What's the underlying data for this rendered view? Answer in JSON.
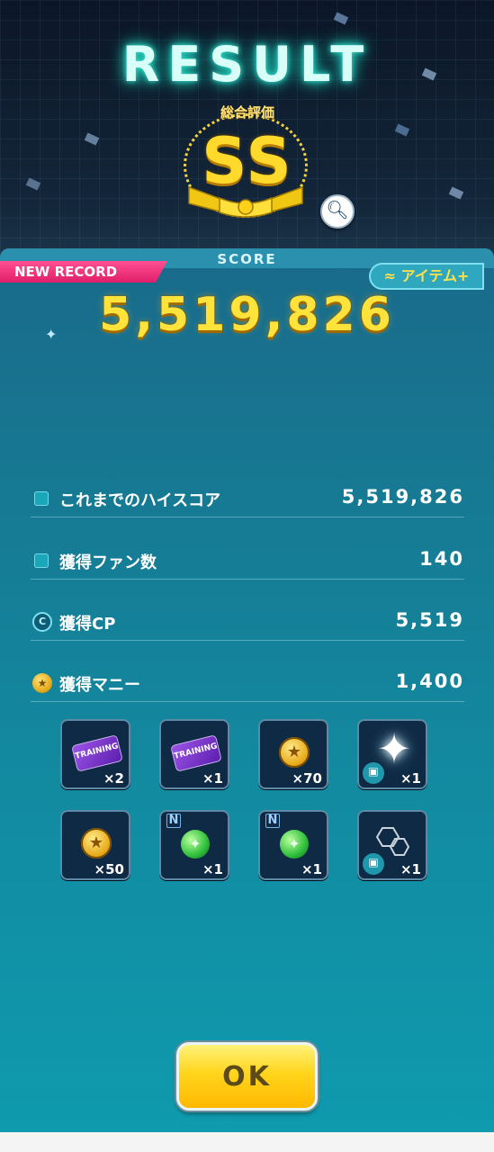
{
  "header": {
    "title": "RESULT",
    "rank_label": "総合評価",
    "rank": "SS",
    "zoom_icon": "magnifier-icon"
  },
  "score": {
    "label": "SCORE",
    "new_record": "NEW RECORD",
    "item_plus": "≈ アイテム+",
    "value": "5,519,826"
  },
  "stats": [
    {
      "label": "これまでのハイスコア",
      "value": "5,519,826",
      "icon": "square-bullet-icon"
    },
    {
      "label": "獲得ファン数",
      "value": "140",
      "icon": "square-bullet-icon"
    },
    {
      "label": "獲得CP",
      "value": "5,519",
      "icon": "cp-coin-icon",
      "icon_text": "C"
    },
    {
      "label": "獲得マニー",
      "value": "1,400",
      "icon": "money-coin-icon",
      "icon_text": "★"
    }
  ],
  "rewards": [
    {
      "type": "training-ticket",
      "count": "×2",
      "ticket_text": "TRAINING"
    },
    {
      "type": "training-ticket",
      "count": "×1",
      "ticket_text": "TRAINING"
    },
    {
      "type": "money-coin",
      "count": "×70"
    },
    {
      "type": "sparkle-effect",
      "count": "×1"
    },
    {
      "type": "money-coin",
      "count": "×50"
    },
    {
      "type": "green-gem",
      "count": "×1",
      "badge": "N"
    },
    {
      "type": "green-gem",
      "count": "×1",
      "badge": "N"
    },
    {
      "type": "hexagon-frame",
      "count": "×1"
    }
  ],
  "buttons": {
    "ok": "OK"
  },
  "colors": {
    "gold": "#ffd92c",
    "new_record_pink": "#e01f6a",
    "panel_teal": "#128aa0",
    "title_glow": "#36e6d2"
  }
}
